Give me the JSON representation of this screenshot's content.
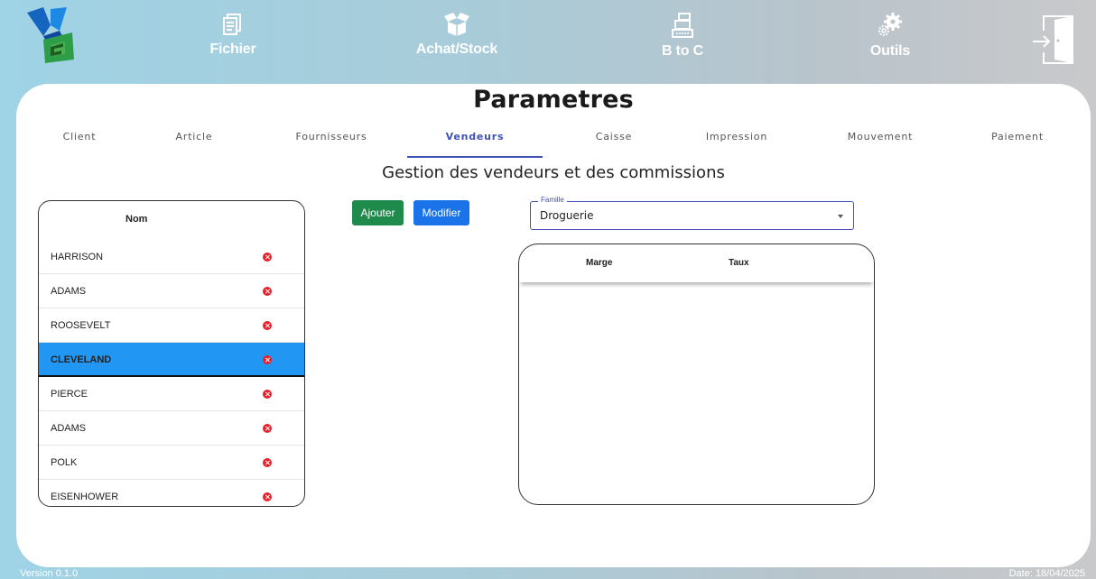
{
  "nav": {
    "items": [
      {
        "label": "Fichier",
        "icon": "file-icon"
      },
      {
        "label": "Achat/Stock",
        "icon": "box-icon"
      },
      {
        "label": "B to C",
        "icon": "cash-register-icon"
      },
      {
        "label": "Outils",
        "icon": "gears-icon"
      }
    ]
  },
  "page": {
    "title": "Parametres",
    "section_title": "Gestion des vendeurs et des commissions"
  },
  "tabs": [
    {
      "label": "Client"
    },
    {
      "label": "Article"
    },
    {
      "label": "Fournisseurs"
    },
    {
      "label": "Vendeurs",
      "active": true
    },
    {
      "label": "Caisse"
    },
    {
      "label": "Impression"
    },
    {
      "label": "Mouvement"
    },
    {
      "label": "Paiement"
    }
  ],
  "vendeurs": {
    "header": "Nom",
    "rows": [
      {
        "name": "HARRISON"
      },
      {
        "name": "ADAMS"
      },
      {
        "name": "ROOSEVELT"
      },
      {
        "name": "CLEVELAND",
        "selected": true
      },
      {
        "name": "PIERCE"
      },
      {
        "name": "ADAMS"
      },
      {
        "name": "POLK"
      },
      {
        "name": "EISENHOWER"
      }
    ]
  },
  "buttons": {
    "add_label": "Ajouter",
    "edit_label": "Modifier"
  },
  "famille": {
    "legend": "Famille",
    "value": "Droguerie"
  },
  "commissions": {
    "col_marge": "Marge",
    "col_taux": "Taux"
  },
  "footer": {
    "version": "Version 0.1.0",
    "date": "Date: 18/04/2025"
  },
  "colors": {
    "accent": "#3f51b5",
    "selected_row": "#2196f3",
    "add_button": "#1e8a4c",
    "edit_button": "#1a73e8",
    "delete": "#e8202a"
  }
}
